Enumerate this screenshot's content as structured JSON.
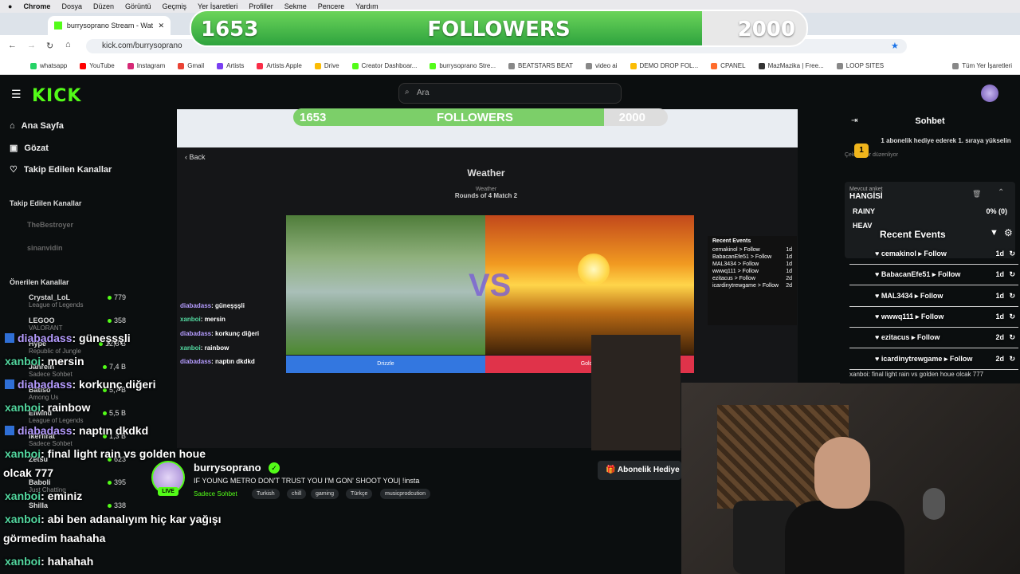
{
  "menubar": {
    "apple": "",
    "items": [
      "Chrome",
      "Dosya",
      "Düzen",
      "Görüntü",
      "Geçmiş",
      "Yer İşaretleri",
      "Profiller",
      "Sekme",
      "Pencere",
      "Yardım"
    ]
  },
  "browser": {
    "active_tab": "burrysoprano Stream - Watch",
    "url": "kick.com/burrysoprano",
    "bookmarks": [
      "whatsapp",
      "YouTube",
      "Instagram",
      "Gmail",
      "Artists",
      "Artists Apple",
      "Drive",
      "Creator Dashboar...",
      "burrysoprano Stre...",
      "BEATSTARS BEAT",
      "video ai",
      "DEMO DROP FOL...",
      "CPANEL",
      "MazMazika | Free...",
      "LOOP SITES",
      "Tüm Yer İşaretleri"
    ]
  },
  "followers_goal": {
    "current": "1653",
    "label": "FOLLOWERS",
    "target": "2000",
    "fraction": 0.83
  },
  "kick": {
    "logo": "KICK",
    "search_placeholder": "Ara",
    "nav": {
      "home": "Ana Sayfa",
      "browse": "Gözat",
      "following": "Takip Edilen Kanallar"
    },
    "followed_header": "Takip Edilen Kanallar",
    "followed": [
      "TheBestroyer",
      "sinanvidin"
    ],
    "recommended_header": "Önerilen Kanallar",
    "recommended": [
      {
        "name": "Crystal_LoL",
        "cat": "League of Legends",
        "count": "779"
      },
      {
        "name": "LEGOO",
        "cat": "VALORANT",
        "count": "358"
      },
      {
        "name": "Hype",
        "cat": "Republic of Jungle",
        "count": "12,8 B"
      },
      {
        "name": "Jahrein",
        "cat": "Sadece Sohbet",
        "count": "7,4 B"
      },
      {
        "name": "Batiso",
        "cat": "Among Us",
        "count": "5,7 B"
      },
      {
        "name": "Elwind",
        "cat": "League of Legends",
        "count": "5,5 B"
      },
      {
        "name": "ikerfirat",
        "cat": "Sadece Sohbet",
        "count": "1,3 B"
      },
      {
        "name": "Zetsu",
        "cat": "",
        "count": "623"
      },
      {
        "name": "Baboli",
        "cat": "Just Chatting",
        "count": "395"
      },
      {
        "name": "Shilla",
        "cat": "",
        "count": "338"
      }
    ]
  },
  "stream": {
    "inner_followers": {
      "current": "1653",
      "label": "FOLLOWERS",
      "target": "2000",
      "fraction": 0.83
    },
    "back": "Back",
    "game_title": "Weather",
    "game_sub1": "Weather",
    "game_sub2": "Rounds of 4 Match 2",
    "vs": "VS",
    "left_btn": "Drizzle",
    "right_btn": "Golden",
    "inner_events_title": "Recent Events",
    "inner_events": [
      "cemakinol > Follow",
      "BabacanEfe51 > Follow",
      "MAL3434 > Follow",
      "wwwq111 > Follow",
      "ezitacus > Follow",
      "icardinytrewgame > Follow"
    ],
    "inner_event_ages": [
      "1d",
      "1d",
      "1d",
      "1d",
      "2d",
      "2d"
    ]
  },
  "streamer": {
    "name": "burrysoprano",
    "live": "LIVE",
    "title": "IF YOUNG METRO DON'T TRUST YOU I'M GON' SHOOT YOU| !insta",
    "category": "Sadece Sohbet",
    "tags": [
      "Turkish",
      "chill",
      "gaming",
      "Türkçe",
      "musicprodcution"
    ],
    "sub_gift": "Abonelik Hediye"
  },
  "chat": {
    "title": "Sohbet",
    "pinned": "1 abonelik hediye ederek 1. sıraya yükselin",
    "pinned_extra": "Çekilmeler düzenliyor",
    "poll_label": "Mevcut anket",
    "poll_question": "HANGİSİ",
    "poll_option": "RAINY",
    "poll_value": "0% (0)",
    "poll_option2": "HEAV",
    "recent_title": "Recent Events",
    "events": [
      {
        "name": "cemakinol",
        "action": "Follow",
        "ago": "1d"
      },
      {
        "name": "BabacanEfe51",
        "action": "Follow",
        "ago": "1d"
      },
      {
        "name": "MAL3434",
        "action": "Follow",
        "ago": "1d"
      },
      {
        "name": "wwwq111",
        "action": "Follow",
        "ago": "1d"
      },
      {
        "name": "ezitacus",
        "action": "Follow",
        "ago": "2d"
      },
      {
        "name": "icardinytrewgame",
        "action": "Follow",
        "ago": "2d"
      }
    ],
    "bottom_msg": "xanboi: final light rain vs golden houe olcak 777"
  },
  "overlay_chat": [
    {
      "user": "diabadass",
      "text": ": güneşşşli",
      "kind": "a"
    },
    {
      "user": "xanboi",
      "text": ": mersin",
      "kind": "x"
    },
    {
      "user": "diabadass",
      "text": ": korkunç diğeri",
      "kind": "a"
    },
    {
      "user": "xanboi",
      "text": ": rainbow",
      "kind": "x"
    },
    {
      "user": "diabadass",
      "text": ": naptın dkdkd",
      "kind": "a"
    },
    {
      "user": "xanboi",
      "text": ": final light rain vs golden houe",
      "kind": "x"
    },
    {
      "user": "",
      "text": "olcak 777",
      "kind": "cont"
    },
    {
      "user": "xanboi",
      "text": ": eminiz",
      "kind": "x"
    },
    {
      "user": "xanboi",
      "text": ": abi ben adanalıyım hiç kar yağışı",
      "kind": "x"
    },
    {
      "user": "",
      "text": "görmedim haahaha",
      "kind": "cont"
    },
    {
      "user": "xanboi",
      "text": ": hahahah",
      "kind": "x"
    }
  ]
}
